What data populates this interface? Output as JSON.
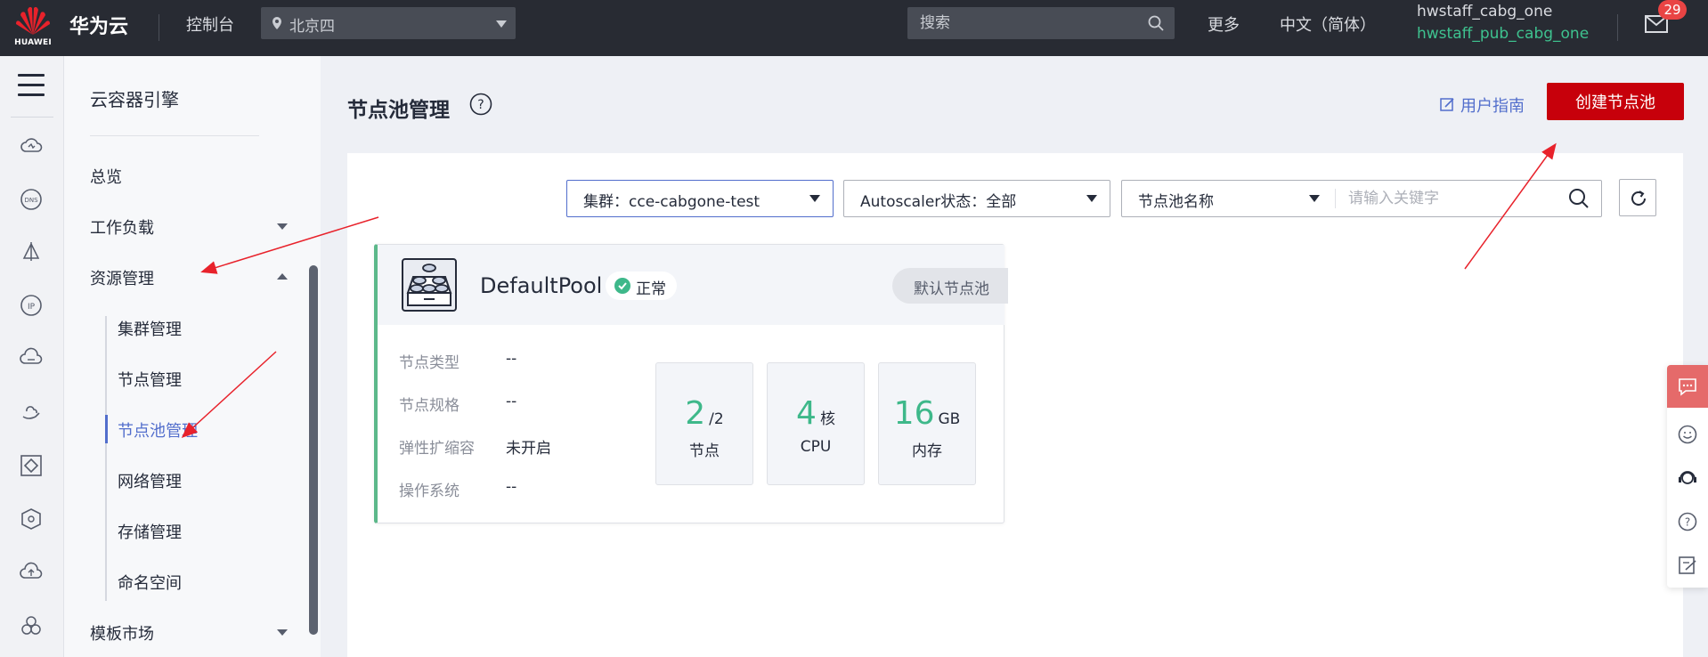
{
  "topbar": {
    "logo_text": "HUAWEI",
    "brand": "华为云",
    "console": "控制台",
    "region": "北京四",
    "search_placeholder": "搜索",
    "more": "更多",
    "language": "中文（简体）",
    "user_account": "hwstaff_cabg_one",
    "user_sub_account": "hwstaff_pub_cabg_one",
    "mail_badge": "29"
  },
  "rail": {
    "icons": [
      "cloud-icon",
      "dns-icon",
      "sail-icon",
      "ip-icon",
      "cloud-gateway-icon",
      "hand-cloud-icon",
      "diamond-icon",
      "cube-gear-icon",
      "cloud-upload-icon",
      "hexagon-cluster-icon"
    ]
  },
  "nav": {
    "title": "云容器引擎",
    "items": [
      {
        "label": "总览"
      },
      {
        "label": "工作负载"
      },
      {
        "label": "资源管理"
      }
    ],
    "sub_items": [
      {
        "label": "集群管理"
      },
      {
        "label": "节点管理"
      },
      {
        "label": "节点池管理"
      },
      {
        "label": "网络管理"
      },
      {
        "label": "存储管理"
      },
      {
        "label": "命名空间"
      }
    ],
    "market": "模板市场"
  },
  "main": {
    "title": "节点池管理",
    "guide": "用户指南",
    "create_button": "创建节点池"
  },
  "filters": {
    "cluster": "集群：cce-cabgone-test",
    "autoscaler": "Autoscaler状态：全部",
    "pool_name": "节点池名称",
    "keyword_placeholder": "请输入关键字"
  },
  "pool": {
    "name": "DefaultPool",
    "status": "正常",
    "tag": "默认节点池",
    "props": [
      {
        "label": "节点类型",
        "value": "--"
      },
      {
        "label": "节点规格",
        "value": "--"
      },
      {
        "label": "弹性扩缩容",
        "value": "未开启"
      },
      {
        "label": "操作系统",
        "value": "--"
      }
    ],
    "stats": [
      {
        "value": "2",
        "unit": "/2",
        "label": "节点"
      },
      {
        "value": "4",
        "unit": "核",
        "label": "CPU"
      },
      {
        "value": "16",
        "unit": "GB",
        "label": "内存"
      }
    ]
  },
  "colors": {
    "accent": "#526ecc",
    "brand_red": "#c7000b",
    "success": "#3eb88a",
    "topbar": "#282b33"
  }
}
